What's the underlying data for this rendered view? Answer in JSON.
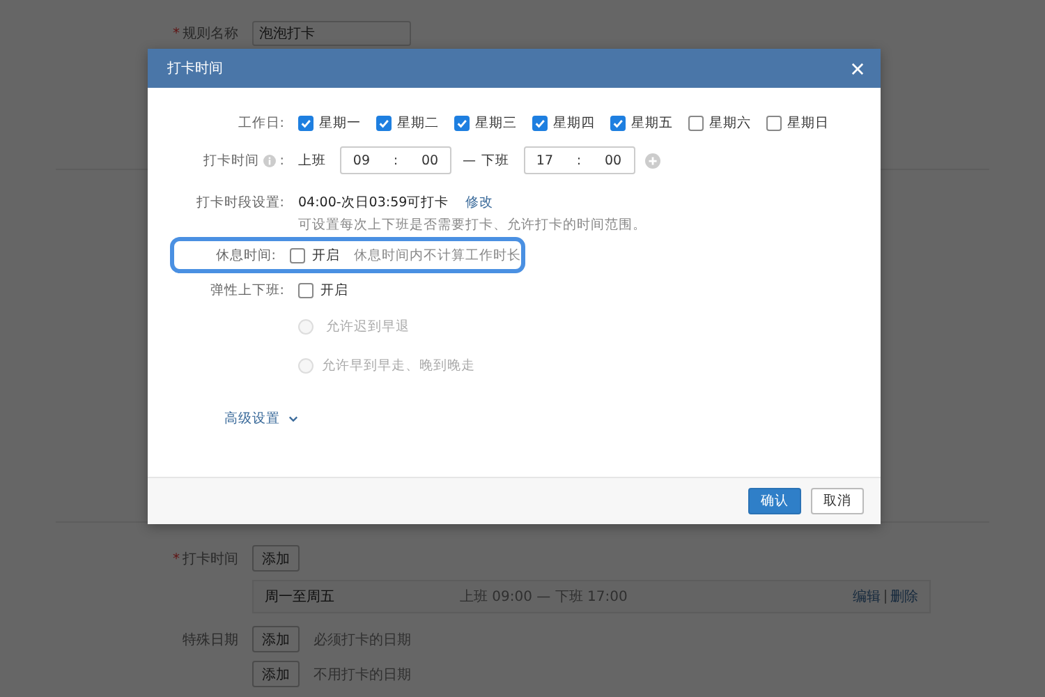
{
  "background_form": {
    "rule_name": {
      "required_mark": "*",
      "label": "规则名称",
      "value": "泡泡打卡"
    },
    "check_in": {
      "required_mark": "*",
      "label": "打卡时间",
      "button": "添加",
      "schedule": {
        "days": "周一至周五",
        "hours": "上班 09:00 — 下班 17:00",
        "actions": [
          "编辑",
          "删除"
        ]
      }
    },
    "special_dates": [
      {
        "label": "特殊日期",
        "button": "添加",
        "note": "必须打卡的日期"
      },
      {
        "button": "添加",
        "note": "不用打卡的日期"
      }
    ]
  },
  "dialog": {
    "title": "打卡时间",
    "workdays": {
      "label": "工作日:",
      "days": [
        {
          "label": "星期一",
          "checked": true
        },
        {
          "label": "星期二",
          "checked": true
        },
        {
          "label": "星期三",
          "checked": true
        },
        {
          "label": "星期四",
          "checked": true
        },
        {
          "label": "星期五",
          "checked": true
        },
        {
          "label": "星期六",
          "checked": false
        },
        {
          "label": "星期日",
          "checked": false
        }
      ]
    },
    "check_time": {
      "label": "打卡时间",
      "colon": ":",
      "start_label": "上班",
      "start_hour": "09",
      "start_minute": "00",
      "dash": "—",
      "end_label": "下班",
      "end_hour": "17",
      "end_minute": "00",
      "sep": ":"
    },
    "period": {
      "label": "打卡时段设置:",
      "value": "04:00-次日03:59可打卡",
      "link": "修改",
      "hint": "可设置每次上下班是否需要打卡、允许打卡的时间范围。"
    },
    "break_time": {
      "label": "休息时间:",
      "checked": false,
      "option": "开启",
      "note": "休息时间内不计算工作时长",
      "highlighted": true
    },
    "flexible": {
      "label": "弹性上下班:",
      "checked": false,
      "option": "开启",
      "choices": [
        {
          "label": "允许迟到早退",
          "selected": false,
          "disabled": true
        },
        {
          "label": "允许早到早走、晚到晚走",
          "selected": false,
          "disabled": true
        }
      ]
    },
    "advanced": "高级设置",
    "buttons": {
      "confirm": "确认",
      "cancel": "取消"
    }
  }
}
